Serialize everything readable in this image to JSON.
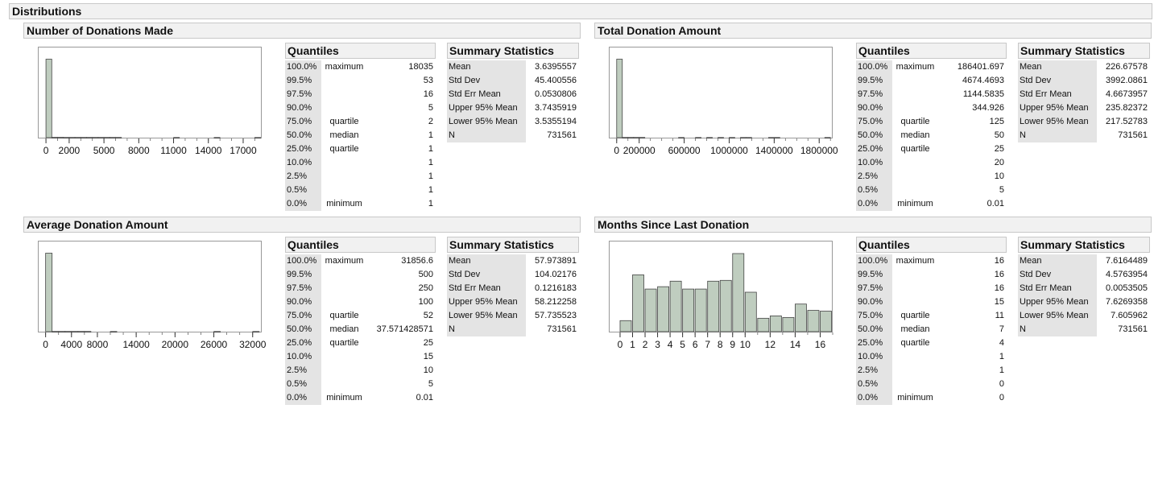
{
  "report": {
    "title": "Distributions"
  },
  "colors": {
    "bar_fill": "#bfcdbf",
    "bar_stroke": "#444444",
    "header_bg": "#f1f1f1",
    "label_bg": "#e4e4e4"
  },
  "quantile_labels": {
    "pcts": [
      "100.0%",
      "99.5%",
      "97.5%",
      "90.0%",
      "75.0%",
      "50.0%",
      "25.0%",
      "10.0%",
      "2.5%",
      "0.5%",
      "0.0%"
    ],
    "names": [
      "maximum",
      "",
      "",
      "",
      "quartile",
      "median",
      "quartile",
      "",
      "",
      "",
      "minimum"
    ]
  },
  "stat_labels": [
    "Mean",
    "Std Dev",
    "Std Err Mean",
    "Upper 95% Mean",
    "Lower 95% Mean",
    "N"
  ],
  "panels": [
    {
      "title": "Number of Donations Made",
      "quantiles_title": "Quantiles",
      "quantiles": [
        "18035",
        "53",
        "16",
        "5",
        "2",
        "1",
        "1",
        "1",
        "1",
        "1",
        "1"
      ],
      "summary_title": "Summary Statistics",
      "summary": [
        "3.6395557",
        "45.400556",
        "0.0530806",
        "3.7435919",
        "3.5355194",
        "731561"
      ],
      "chart_data": {
        "type": "bar",
        "xlim": [
          -700,
          18600
        ],
        "ylim": [
          0,
          100
        ],
        "bin_width": 500,
        "x": [
          0,
          500,
          1000,
          1500,
          2000,
          2500,
          3000,
          3500,
          4000,
          4500,
          5000,
          5500,
          6000,
          6500,
          7000,
          7500,
          8000,
          8500,
          9000,
          9500,
          10000,
          10500,
          11000,
          11500,
          12000,
          12500,
          13000,
          13500,
          14000,
          14500,
          15000,
          15500,
          16000,
          16500,
          17000,
          17500,
          18000
        ],
        "values": [
          99.5,
          0.4,
          0.4,
          0.3,
          0.3,
          0.3,
          0.3,
          0.3,
          0.3,
          0.3,
          0.3,
          0.3,
          0.3,
          0,
          0,
          0,
          0,
          0,
          0,
          0,
          0,
          0,
          0.2,
          0,
          0,
          0,
          0,
          0,
          0,
          0.2,
          0,
          0,
          0,
          0,
          0,
          0,
          0.2
        ],
        "xticks": [
          0,
          2000,
          5000,
          8000,
          11000,
          14000,
          17000
        ]
      }
    },
    {
      "title": "Total Donation Amount",
      "quantiles_title": "Quantiles",
      "quantiles": [
        "186401.697",
        "4674.4693",
        "1144.5835",
        "344.926",
        "125",
        "50",
        "25",
        "20",
        "10",
        "5",
        "0.01"
      ],
      "summary_title": "Summary Statistics",
      "summary": [
        "226.67578",
        "3992.0861",
        "4.6673957",
        "235.82372",
        "217.52783",
        "731561"
      ],
      "chart_data": {
        "type": "bar",
        "xlim": [
          -70000,
          1920000
        ],
        "ylim": [
          0,
          100
        ],
        "bin_width": 50000,
        "x": [
          0,
          50000,
          100000,
          150000,
          200000,
          250000,
          300000,
          350000,
          400000,
          450000,
          500000,
          550000,
          600000,
          650000,
          700000,
          750000,
          800000,
          850000,
          900000,
          950000,
          1000000,
          1050000,
          1100000,
          1150000,
          1200000,
          1250000,
          1300000,
          1350000,
          1400000,
          1450000,
          1500000,
          1550000,
          1600000,
          1650000,
          1700000,
          1750000,
          1800000,
          1850000
        ],
        "values": [
          99.5,
          0.3,
          0.3,
          0.3,
          0.3,
          0,
          0,
          0,
          0,
          0,
          0,
          0.2,
          0,
          0,
          0.2,
          0,
          0.2,
          0,
          0.2,
          0,
          0.2,
          0,
          0.2,
          0.2,
          0,
          0,
          0,
          0.2,
          0.2,
          0,
          0,
          0,
          0,
          0,
          0,
          0,
          0,
          0.2
        ],
        "xticks": [
          0,
          200000,
          600000,
          1000000,
          1400000,
          1800000
        ]
      }
    },
    {
      "title": "Average Donation Amount",
      "quantiles_title": "Quantiles",
      "quantiles": [
        "31856.6",
        "500",
        "250",
        "100",
        "52",
        "37.571428571",
        "25",
        "15",
        "10",
        "5",
        "0.01"
      ],
      "summary_title": "Summary Statistics",
      "summary": [
        "57.973891",
        "104.02176",
        "0.1216183",
        "58.212258",
        "57.735523",
        "731561"
      ],
      "chart_data": {
        "type": "bar",
        "xlim": [
          -1200,
          33400
        ],
        "ylim": [
          0,
          100
        ],
        "bin_width": 1000,
        "x": [
          0,
          1000,
          2000,
          3000,
          4000,
          5000,
          6000,
          7000,
          8000,
          9000,
          10000,
          11000,
          12000,
          13000,
          14000,
          15000,
          16000,
          17000,
          18000,
          19000,
          20000,
          21000,
          22000,
          23000,
          24000,
          25000,
          26000,
          27000,
          28000,
          29000,
          30000,
          31000,
          32000
        ],
        "values": [
          99.5,
          0.3,
          0.3,
          0.3,
          0.3,
          0.3,
          0.3,
          0,
          0,
          0,
          0.2,
          0,
          0,
          0,
          0,
          0,
          0,
          0,
          0,
          0,
          0,
          0,
          0,
          0,
          0,
          0,
          0.2,
          0,
          0,
          0,
          0,
          0,
          0.2
        ],
        "xticks": [
          0,
          4000,
          8000,
          14000,
          20000,
          26000,
          32000
        ]
      }
    },
    {
      "title": "Months Since Last Donation",
      "quantiles_title": "Quantiles",
      "quantiles": [
        "16",
        "16",
        "16",
        "15",
        "11",
        "7",
        "4",
        "1",
        "1",
        "0",
        "0"
      ],
      "summary_title": "Summary Statistics",
      "summary": [
        "7.6164489",
        "4.5763954",
        "0.0053505",
        "7.6269358",
        "7.605962",
        "731561"
      ],
      "chart_data": {
        "type": "bar",
        "xlim": [
          -0.9,
          17.0
        ],
        "ylim": [
          0,
          100
        ],
        "bin_width": 1,
        "x": [
          0,
          1,
          2,
          3,
          4,
          5,
          6,
          7,
          8,
          9,
          10,
          11,
          12,
          13,
          14,
          15,
          16
        ],
        "values": [
          14,
          72,
          54,
          57,
          64,
          54,
          54,
          64,
          65,
          99,
          50,
          17,
          20,
          18,
          35,
          27,
          26
        ],
        "xticks": [
          0,
          1,
          2,
          3,
          4,
          5,
          6,
          7,
          8,
          9,
          10,
          12,
          14,
          16
        ]
      }
    }
  ]
}
